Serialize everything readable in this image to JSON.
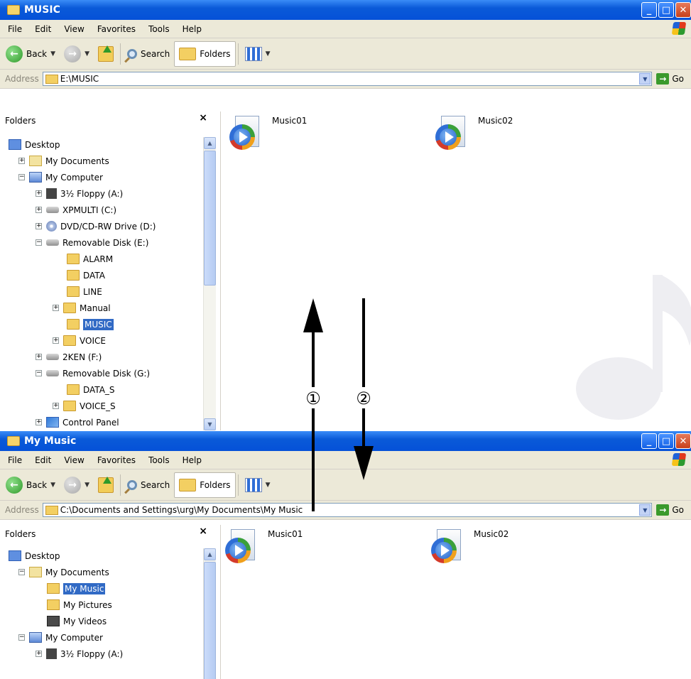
{
  "top_window": {
    "title": "MUSIC",
    "menu": [
      "File",
      "Edit",
      "View",
      "Favorites",
      "Tools",
      "Help"
    ],
    "toolbar": {
      "back": "Back",
      "search": "Search",
      "folders": "Folders"
    },
    "address": {
      "label": "Address",
      "value": "E:\\MUSIC",
      "go": "Go"
    },
    "folders_pane": {
      "title": "Folders",
      "close": "×",
      "tree": [
        {
          "label": "Desktop"
        },
        {
          "label": "My Documents"
        },
        {
          "label": "My Computer"
        },
        {
          "label": "3½ Floppy (A:)"
        },
        {
          "label": "XPMULTI (C:)"
        },
        {
          "label": "DVD/CD-RW Drive (D:)"
        },
        {
          "label": "Removable Disk (E:)"
        },
        {
          "label": "ALARM"
        },
        {
          "label": "DATA"
        },
        {
          "label": "LINE"
        },
        {
          "label": "Manual"
        },
        {
          "label": "MUSIC"
        },
        {
          "label": "VOICE"
        },
        {
          "label": "2KEN (F:)"
        },
        {
          "label": "Removable Disk (G:)"
        },
        {
          "label": "DATA_S"
        },
        {
          "label": "VOICE_S"
        },
        {
          "label": "Control Panel"
        }
      ]
    },
    "files": [
      {
        "name": "Music01"
      },
      {
        "name": "Music02"
      }
    ]
  },
  "bottom_window": {
    "title": "My Music",
    "menu": [
      "File",
      "Edit",
      "View",
      "Favorites",
      "Tools",
      "Help"
    ],
    "toolbar": {
      "back": "Back",
      "search": "Search",
      "folders": "Folders"
    },
    "address": {
      "label": "Address",
      "value": "C:\\Documents and Settings\\urg\\My Documents\\My Music",
      "go": "Go"
    },
    "folders_pane": {
      "title": "Folders",
      "close": "×",
      "tree": [
        {
          "label": "Desktop"
        },
        {
          "label": "My Documents"
        },
        {
          "label": "My Music"
        },
        {
          "label": "My Pictures"
        },
        {
          "label": "My Videos"
        },
        {
          "label": "My Computer"
        },
        {
          "label": "3½ Floppy (A:)"
        }
      ]
    },
    "files": [
      {
        "name": "Music01"
      },
      {
        "name": "Music02"
      }
    ]
  },
  "callouts": [
    "①",
    "②"
  ],
  "colors": {
    "titlebar": "#0a5ad8",
    "selection": "#316ac5",
    "toolbar_bg": "#ece9d8"
  }
}
